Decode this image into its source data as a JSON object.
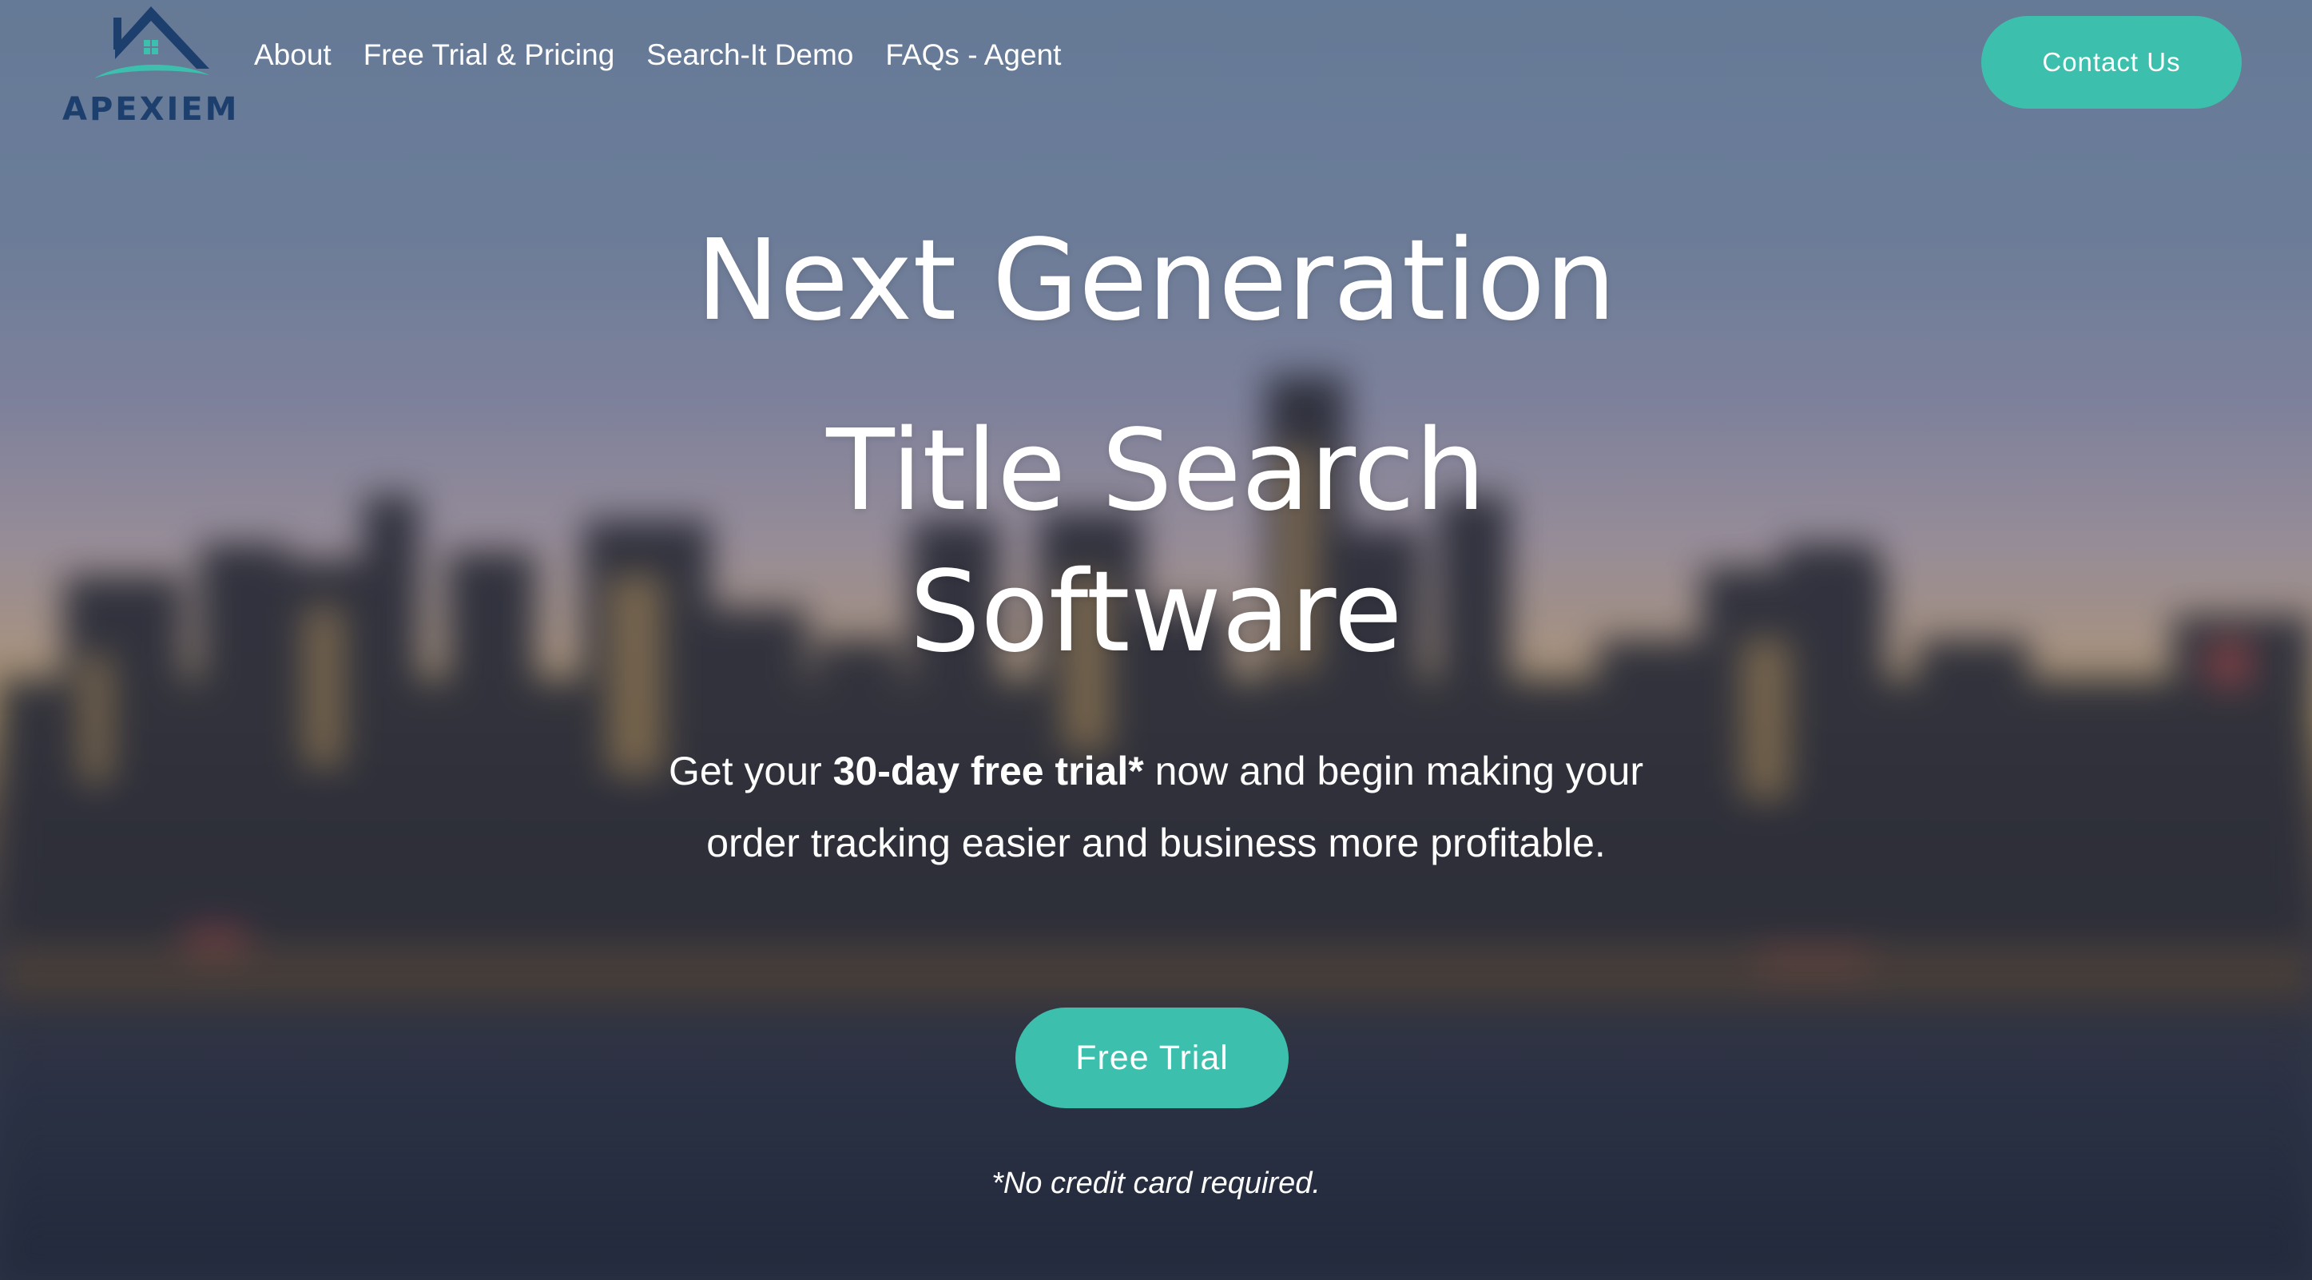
{
  "header": {
    "logo_text": "APEXIEM",
    "nav": [
      {
        "label": "About"
      },
      {
        "label": "Free Trial & Pricing"
      },
      {
        "label": "Search-It Demo"
      },
      {
        "label": "FAQs - Agent"
      }
    ],
    "contact_label": "Contact Us"
  },
  "hero": {
    "line1": "Next Generation",
    "line2": "Title Search",
    "line3": "Software",
    "sub_prefix": "Get your ",
    "sub_bold": "30-day free trial*",
    "sub_suffix": " now and begin making your order tracking easier and business more profitable.",
    "cta_label": "Free Trial",
    "note": "*No credit card required."
  },
  "colors": {
    "accent": "#3dbfad",
    "logo": "#1d3f6e"
  },
  "icons": {
    "logo": "house-roof-icon"
  }
}
